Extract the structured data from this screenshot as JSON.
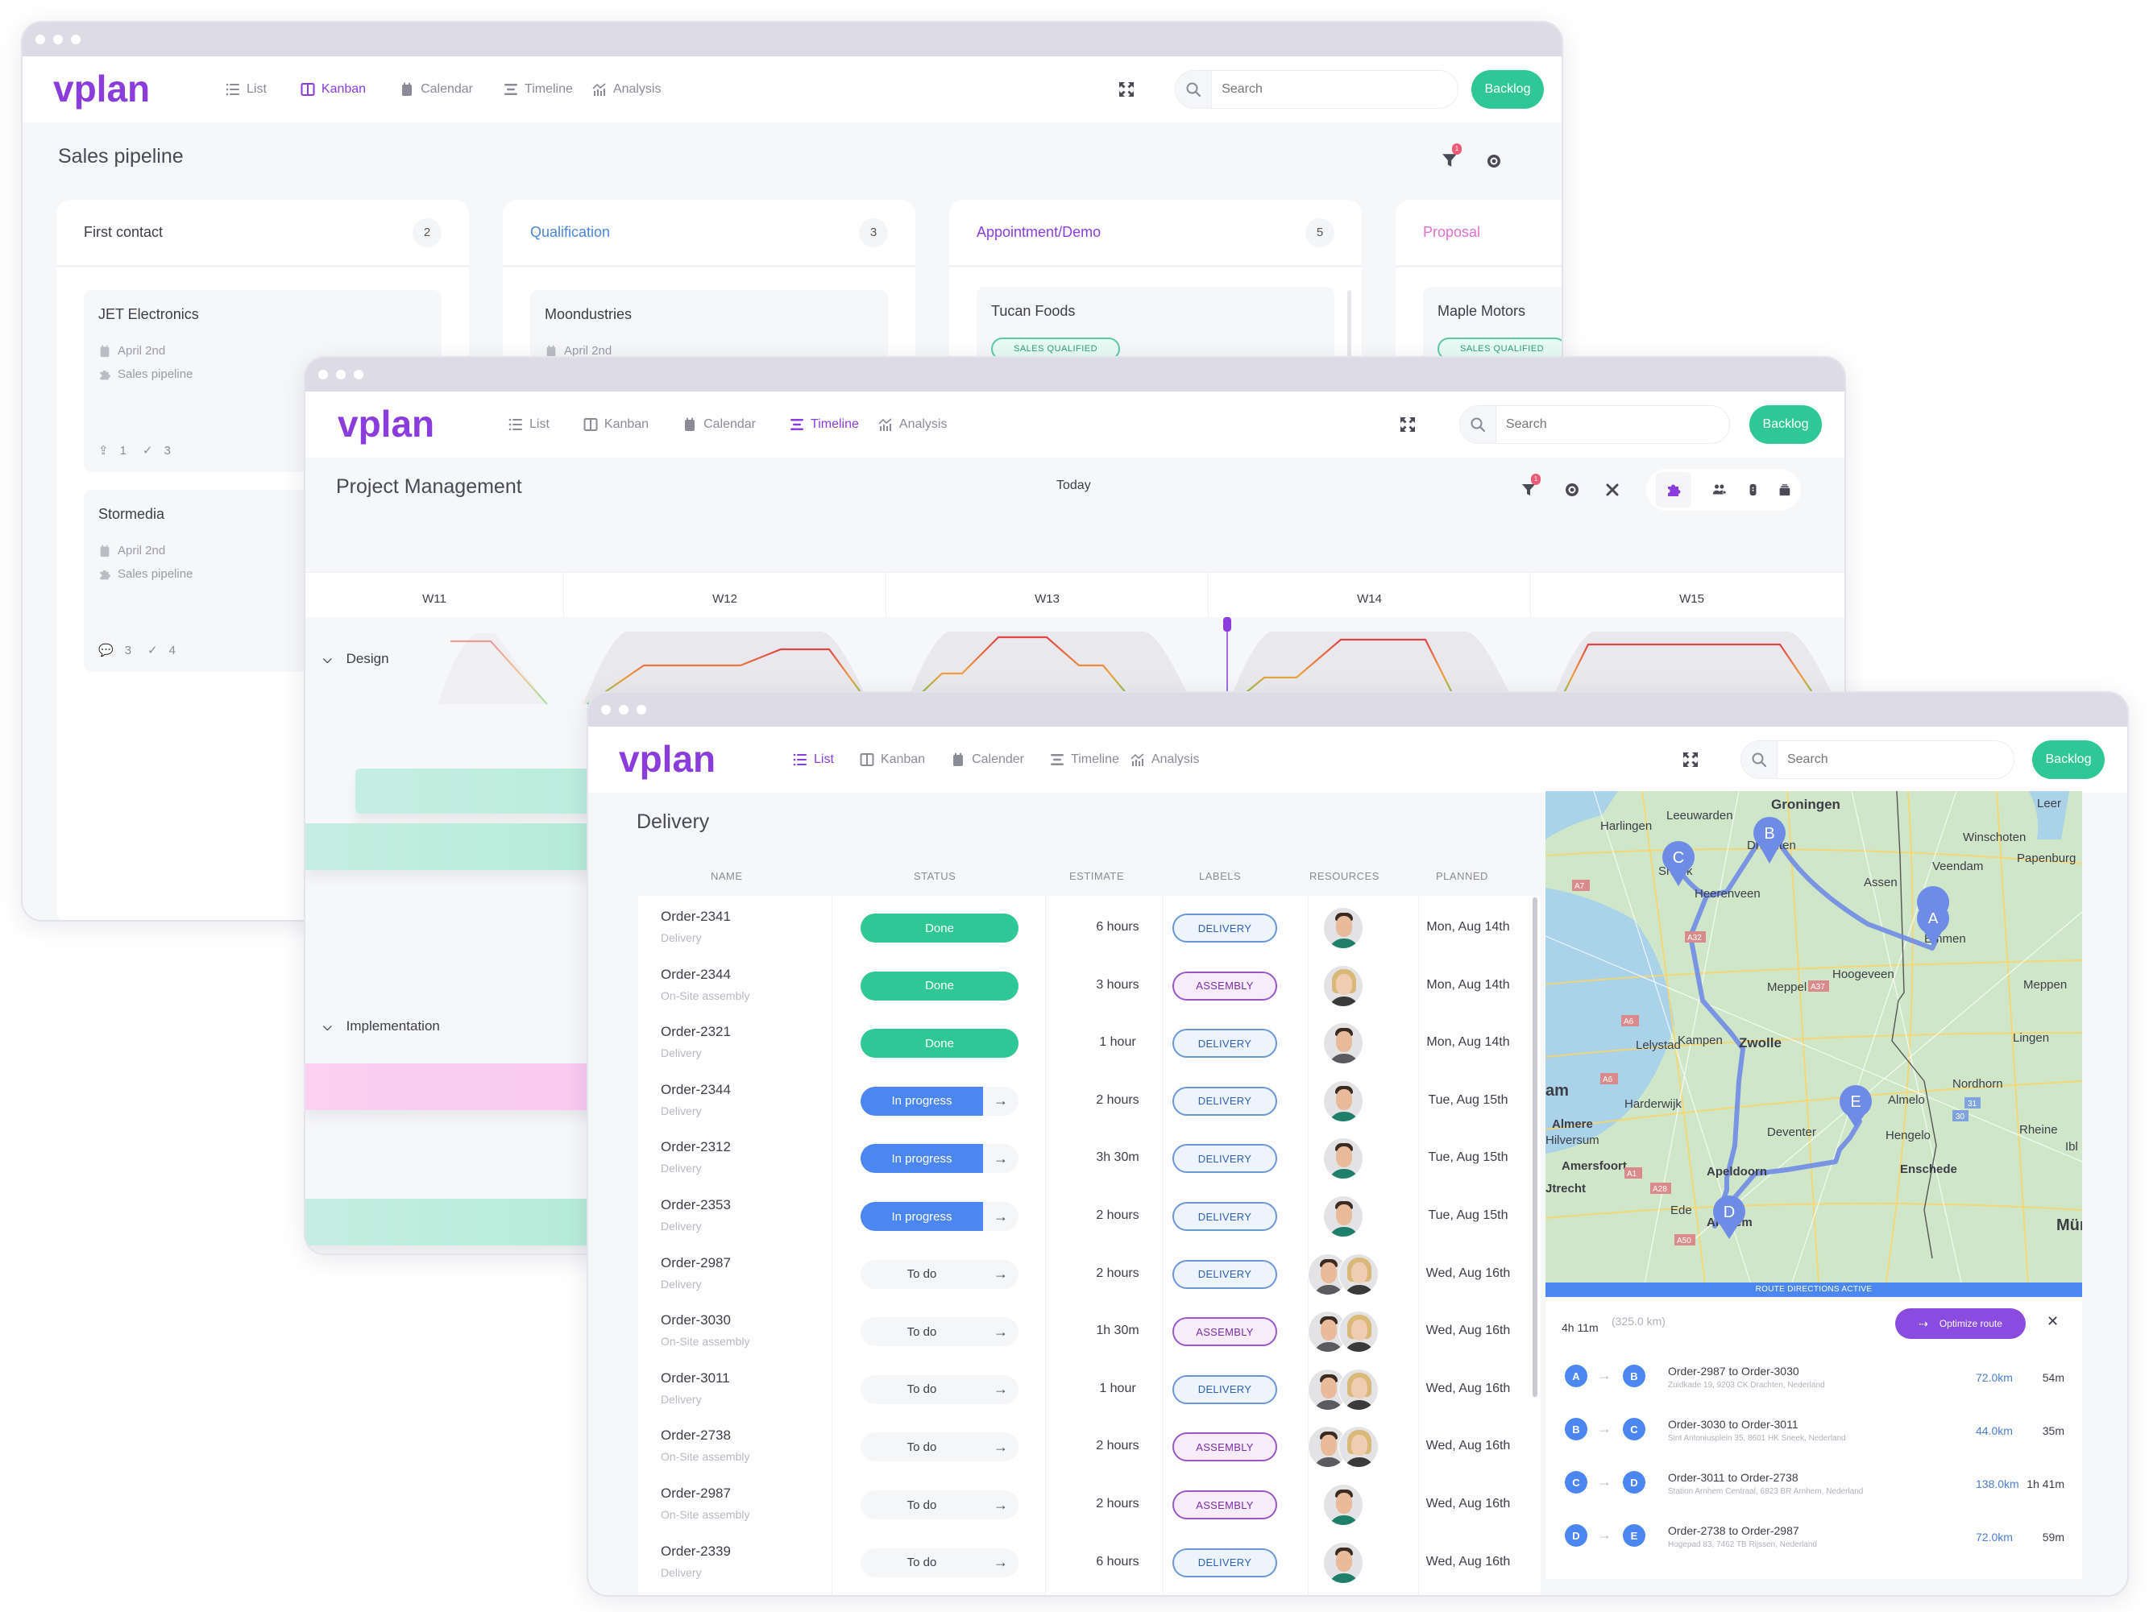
{
  "app": {
    "brand": "vplan",
    "nav": {
      "list": "List",
      "kanban": "Kanban",
      "calendar": "Calendar",
      "calender": "Calender",
      "timeline": "Timeline",
      "analysis": "Analysis"
    },
    "search_placeholder": "Search",
    "backlog_label": "Backlog",
    "accent": "#8a3ddc",
    "success": "#2fc796",
    "info": "#4b86f1"
  },
  "kanban_window": {
    "title": "Sales pipeline",
    "active_tab": "Kanban",
    "filter_badge": "1",
    "columns": [
      {
        "name": "First contact",
        "count": "2",
        "color": "#3d3d48",
        "cards": [
          {
            "title": "JET Electronics",
            "date": "April 2nd",
            "pipeline": "Sales pipeline",
            "attachments": "1",
            "checks": "3"
          },
          {
            "title": "Stormedia",
            "date": "April 2nd",
            "pipeline": "Sales pipeline",
            "comments": "3",
            "checks": "4"
          }
        ]
      },
      {
        "name": "Qualification",
        "count": "3",
        "color": "#4b86d8",
        "cards": [
          {
            "title": "Moondustries",
            "date": "April 2nd"
          }
        ]
      },
      {
        "name": "Appointment/Demo",
        "count": "5",
        "color": "#8a3ddc",
        "cards": [
          {
            "title": "Tucan Foods",
            "tag": "SALES QUALIFIED"
          }
        ]
      },
      {
        "name": "Proposal",
        "count": "",
        "color": "#e06fd0",
        "cards": [
          {
            "title": "Maple Motors",
            "tag": "SALES QUALIFIED"
          }
        ]
      }
    ]
  },
  "timeline_window": {
    "title": "Project Management",
    "active_tab": "Timeline",
    "today_label": "Today",
    "filter_badge": "1",
    "weeks": [
      "W11",
      "W12",
      "W13",
      "W14",
      "W15"
    ],
    "groups": [
      {
        "name": "Design"
      },
      {
        "name": "Implementation"
      }
    ]
  },
  "delivery_window": {
    "title": "Delivery",
    "active_tab": "List",
    "columns": [
      "NAME",
      "STATUS",
      "ESTIMATE",
      "LABELS",
      "RESOURCES",
      "PLANNED"
    ],
    "rows": [
      {
        "order": "Order-2341",
        "type": "Delivery",
        "status": "Done",
        "state": "done",
        "estimate": "6 hours",
        "label": "DELIVERY",
        "resources": [
          "m"
        ],
        "planned": "Mon, Aug 14th"
      },
      {
        "order": "Order-2344",
        "type": "On-Site assembly",
        "status": "Done",
        "state": "done",
        "estimate": "3 hours",
        "label": "ASSEMBLY",
        "resources": [
          "f"
        ],
        "planned": "Mon, Aug 14th"
      },
      {
        "order": "Order-2321",
        "type": "Delivery",
        "status": "Done",
        "state": "done",
        "estimate": "1 hour",
        "label": "DELIVERY",
        "resources": [
          "m2"
        ],
        "planned": "Mon, Aug 14th"
      },
      {
        "order": "Order-2344",
        "type": "Delivery",
        "status": "In progress",
        "state": "progress",
        "estimate": "2 hours",
        "label": "DELIVERY",
        "resources": [
          "m"
        ],
        "planned": "Tue, Aug 15th"
      },
      {
        "order": "Order-2312",
        "type": "Delivery",
        "status": "In progress",
        "state": "progress",
        "estimate": "3h 30m",
        "label": "DELIVERY",
        "resources": [
          "m"
        ],
        "planned": "Tue, Aug 15th"
      },
      {
        "order": "Order-2353",
        "type": "Delivery",
        "status": "In progress",
        "state": "progress",
        "estimate": "2 hours",
        "label": "DELIVERY",
        "resources": [
          "m"
        ],
        "planned": "Tue, Aug 15th"
      },
      {
        "order": "Order-2987",
        "type": "Delivery",
        "status": "To do",
        "state": "todo",
        "estimate": "2 hours",
        "label": "DELIVERY",
        "resources": [
          "m2",
          "f"
        ],
        "planned": "Wed, Aug 16th"
      },
      {
        "order": "Order-3030",
        "type": "On-Site assembly",
        "status": "To do",
        "state": "todo",
        "estimate": "1h 30m",
        "label": "ASSEMBLY",
        "resources": [
          "m2",
          "f"
        ],
        "planned": "Wed, Aug 16th"
      },
      {
        "order": "Order-3011",
        "type": "Delivery",
        "status": "To do",
        "state": "todo",
        "estimate": "1 hour",
        "label": "DELIVERY",
        "resources": [
          "m2",
          "f"
        ],
        "planned": "Wed, Aug 16th"
      },
      {
        "order": "Order-2738",
        "type": "On-Site assembly",
        "status": "To do",
        "state": "todo",
        "estimate": "2 hours",
        "label": "ASSEMBLY",
        "resources": [
          "m2",
          "f"
        ],
        "planned": "Wed, Aug 16th"
      },
      {
        "order": "Order-2987",
        "type": "On-Site assembly",
        "status": "To do",
        "state": "todo",
        "estimate": "2 hours",
        "label": "ASSEMBLY",
        "resources": [
          "m"
        ],
        "planned": "Wed, Aug 16th"
      },
      {
        "order": "Order-2339",
        "type": "Delivery",
        "status": "To do",
        "state": "todo",
        "estimate": "6 hours",
        "label": "DELIVERY",
        "resources": [
          "m"
        ],
        "planned": "Wed, Aug 16th"
      }
    ],
    "map": {
      "places": [
        "Groningen",
        "Leeuwarden",
        "Harlingen",
        "Drachten",
        "Winschoten",
        "Leer",
        "Papenburg",
        "Veendam",
        "Assen",
        "Sneek",
        "Heerenveen",
        "Emmen",
        "Hoogeveen",
        "Meppel",
        "Meppen",
        "Lelystad",
        "Kampen",
        "Zwolle",
        "Lingen",
        "Harderwijk",
        "Almere",
        "Nordhorn",
        "Almelo",
        "Hilversum",
        "Deventer",
        "Hengelo",
        "Rheine",
        "Amersfoort",
        "Apeldoorn",
        "Enschede",
        "Utrecht",
        "Ede",
        "Arnhem",
        "Mün"
      ],
      "road_labels": [
        "A7",
        "A32",
        "A37",
        "A6",
        "A28",
        "A1",
        "A50",
        "31",
        "30"
      ],
      "pins": [
        "A",
        "B",
        "C",
        "D",
        "E"
      ],
      "status_bar": "ROUTE DIRECTIONS ACTIVE"
    },
    "route": {
      "total_time": "4h 11m",
      "total_distance": "(325.0 km)",
      "optimize_label": "Optimize route",
      "legs": [
        {
          "from": "A",
          "to": "B",
          "title": "Order-2987 to Order-3030",
          "address": "Zuidkade 19, 9203 CK Drachten, Nederland",
          "distance": "72.0km",
          "time": "54m"
        },
        {
          "from": "B",
          "to": "C",
          "title": "Order-3030 to Order-3011",
          "address": "Sint Antoniusplein 35, 8601 HK Sneek, Nederland",
          "distance": "44.0km",
          "time": "35m"
        },
        {
          "from": "C",
          "to": "D",
          "title": "Order-3011 to Order-2738",
          "address": "Station Arnhem Centraal, 6823 BR Arnhem, Nederland",
          "distance": "138.0km",
          "time": "1h 41m"
        },
        {
          "from": "D",
          "to": "E",
          "title": "Order-2738 to Order-2987",
          "address": "Hogepad 83, 7462 TB Rijssen, Nederland",
          "distance": "72.0km",
          "time": "59m"
        }
      ]
    }
  }
}
